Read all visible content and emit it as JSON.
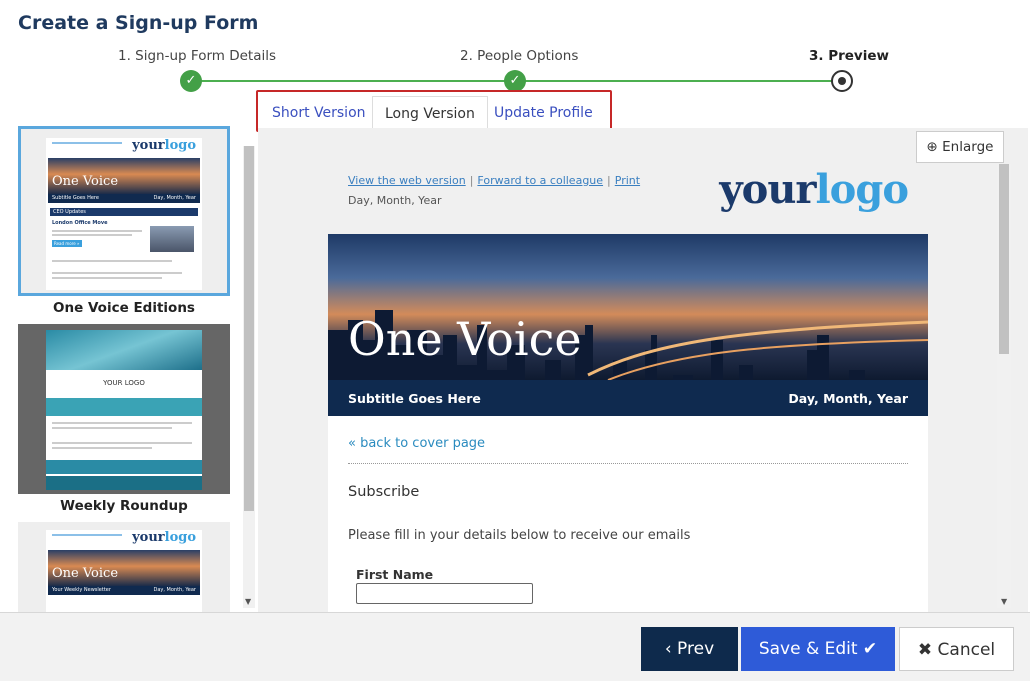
{
  "page": {
    "title": "Create a Sign-up Form"
  },
  "stepper": {
    "steps": [
      {
        "label": "1. Sign-up Form Details",
        "state": "done"
      },
      {
        "label": "2. People Options",
        "state": "done"
      },
      {
        "label": "3. Preview",
        "state": "current"
      }
    ]
  },
  "tabs": [
    {
      "label": "Short Version",
      "selected": false
    },
    {
      "label": "Long Version",
      "selected": true
    },
    {
      "label": "Update Profile",
      "selected": false
    }
  ],
  "templates": [
    {
      "name": "One Voice Editions",
      "selected": true
    },
    {
      "name": "Weekly Roundup",
      "selected": false
    },
    {
      "name": "",
      "selected": false
    }
  ],
  "thumbs": {
    "logo_a": "your",
    "logo_b": "logo",
    "banner_title": "One Voice",
    "sub_label": "Subtitle Goes Here",
    "sub_label_3": "Your Weekly Newsletter",
    "date": "Day, Month, Year",
    "weekly_logo": "YOUR LOGO",
    "section": "CEO Updates",
    "article_title": "London Office Move",
    "read_more": "Read more »"
  },
  "preview": {
    "enlarge_label": "Enlarge",
    "links": [
      "View the web version",
      "Forward to a colleague",
      "Print"
    ],
    "link_separator": "|",
    "date": "Day, Month, Year",
    "logo_part_a": "your",
    "logo_part_b": "logo",
    "banner_title": "One Voice",
    "subtitle": "Subtitle Goes Here",
    "subtitle_date": "Day, Month, Year",
    "back_link": "« back to cover page",
    "heading": "Subscribe",
    "intro": "Please fill in your details below to receive our emails",
    "field_label": "First Name"
  },
  "footer": {
    "prev_label": "Prev",
    "save_label": "Save & Edit",
    "cancel_label": "Cancel"
  },
  "colors": {
    "accent": "#2e5bd8",
    "navy": "#0e2a4c",
    "step_done": "#43a047",
    "highlight_border": "#c62828",
    "selected_thumb": "#5aa7dd"
  }
}
